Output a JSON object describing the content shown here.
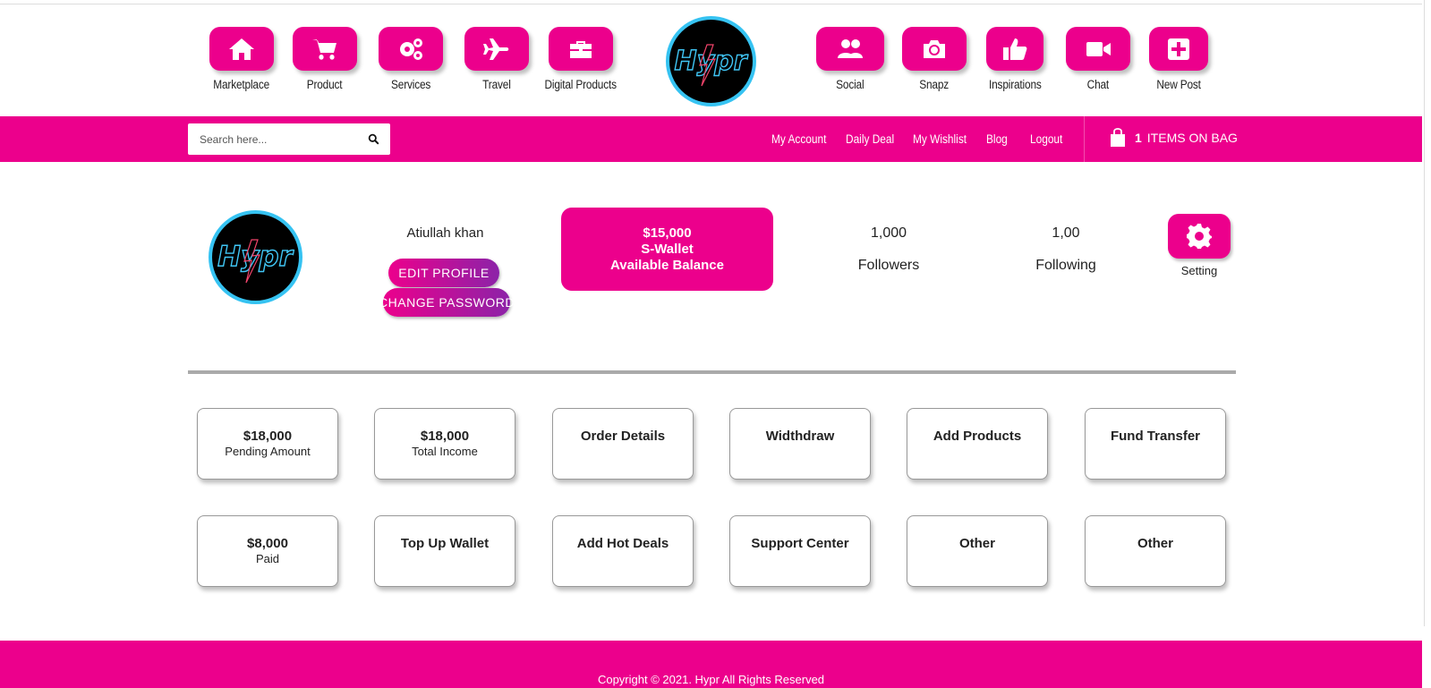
{
  "top_nav_left": [
    {
      "label": "Marketplace",
      "icon": "home-icon"
    },
    {
      "label": "Product",
      "icon": "cart-icon"
    },
    {
      "label": "Services",
      "icon": "gears-icon"
    },
    {
      "label": "Travel",
      "icon": "plane-icon"
    },
    {
      "label": "Digital Products",
      "icon": "briefcase-icon"
    }
  ],
  "top_nav_right": [
    {
      "label": "Social",
      "icon": "users-icon"
    },
    {
      "label": "Snapz",
      "icon": "camera-icon"
    },
    {
      "label": "Inspirations",
      "icon": "thumbs-up-icon"
    },
    {
      "label": "Chat",
      "icon": "video-icon"
    },
    {
      "label": "New Post",
      "icon": "plus-square-icon"
    }
  ],
  "logo": {
    "text": "Hypr"
  },
  "search": {
    "placeholder": "Search here..."
  },
  "menu": [
    "My Account",
    "Daily Deal",
    "My Wishlist",
    "Blog",
    "Logout"
  ],
  "bag": {
    "count": "1",
    "label": "ITEMS ON BAG"
  },
  "profile": {
    "name": "Atiullah khan",
    "edit_label": "EDIT PROFILE",
    "password_label": "CHANGE PASSWORD",
    "wallet_amount": "$15,000",
    "wallet_name": "S-Wallet",
    "wallet_caption": "Available Balance",
    "followers_count": "1,000",
    "followers_label": "Followers",
    "following_count": "1,00",
    "following_label": "Following",
    "setting_label": "Setting"
  },
  "cards": [
    {
      "title": "$18,000",
      "sub": "Pending Amount"
    },
    {
      "title": "$18,000",
      "sub": "Total Income"
    },
    {
      "title": "Order Details",
      "sub": ""
    },
    {
      "title": "Widthdraw",
      "sub": ""
    },
    {
      "title": "Add Products",
      "sub": ""
    },
    {
      "title": "Fund Transfer",
      "sub": ""
    },
    {
      "title": "$8,000",
      "sub": "Paid"
    },
    {
      "title": "Top Up Wallet",
      "sub": ""
    },
    {
      "title": "Add Hot Deals",
      "sub": ""
    },
    {
      "title": "Support Center",
      "sub": ""
    },
    {
      "title": "Other",
      "sub": ""
    },
    {
      "title": "Other",
      "sub": ""
    }
  ],
  "footer": {
    "copyright": "Copyright © 2021. Hypr All Rights Reserved"
  },
  "colors": {
    "brand": "#ec008c",
    "logo_ring": "#36c3f2",
    "gradient_end": "#8c23a8"
  }
}
